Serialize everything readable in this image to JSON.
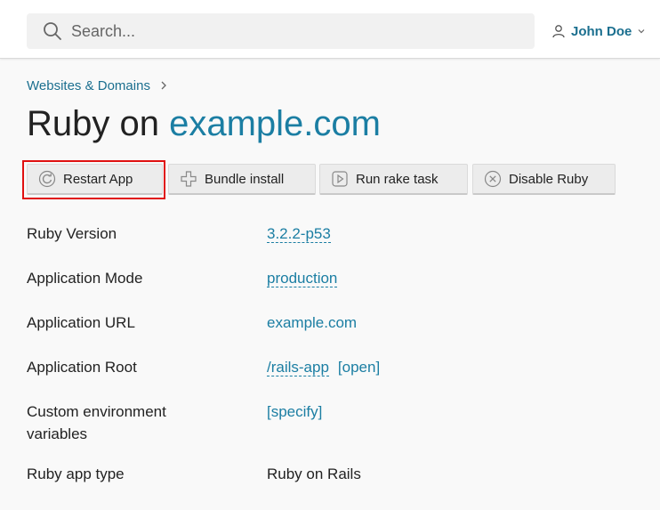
{
  "header": {
    "search_placeholder": "Search...",
    "user_name": "John Doe"
  },
  "breadcrumb": {
    "item": "Websites & Domains"
  },
  "title": {
    "prefix": "Ruby on",
    "domain": "example.com"
  },
  "toolbar": {
    "restart": "Restart App",
    "bundle": "Bundle install",
    "rake": "Run rake task",
    "disable": "Disable Ruby"
  },
  "properties": {
    "ruby_version": {
      "label": "Ruby Version",
      "value": "3.2.2-p53"
    },
    "app_mode": {
      "label": "Application Mode",
      "value": "production"
    },
    "app_url": {
      "label": "Application URL",
      "value": "example.com"
    },
    "app_root": {
      "label": "Application Root",
      "value": "/rails-app",
      "open": "[open]"
    },
    "custom_env": {
      "label": "Custom environment variables",
      "value": "[specify]"
    },
    "app_type": {
      "label": "Ruby app type",
      "value": "Ruby on Rails"
    }
  },
  "colors": {
    "link": "#1b7ea3",
    "highlight": "#e01010",
    "button_bg": "#ececec"
  }
}
